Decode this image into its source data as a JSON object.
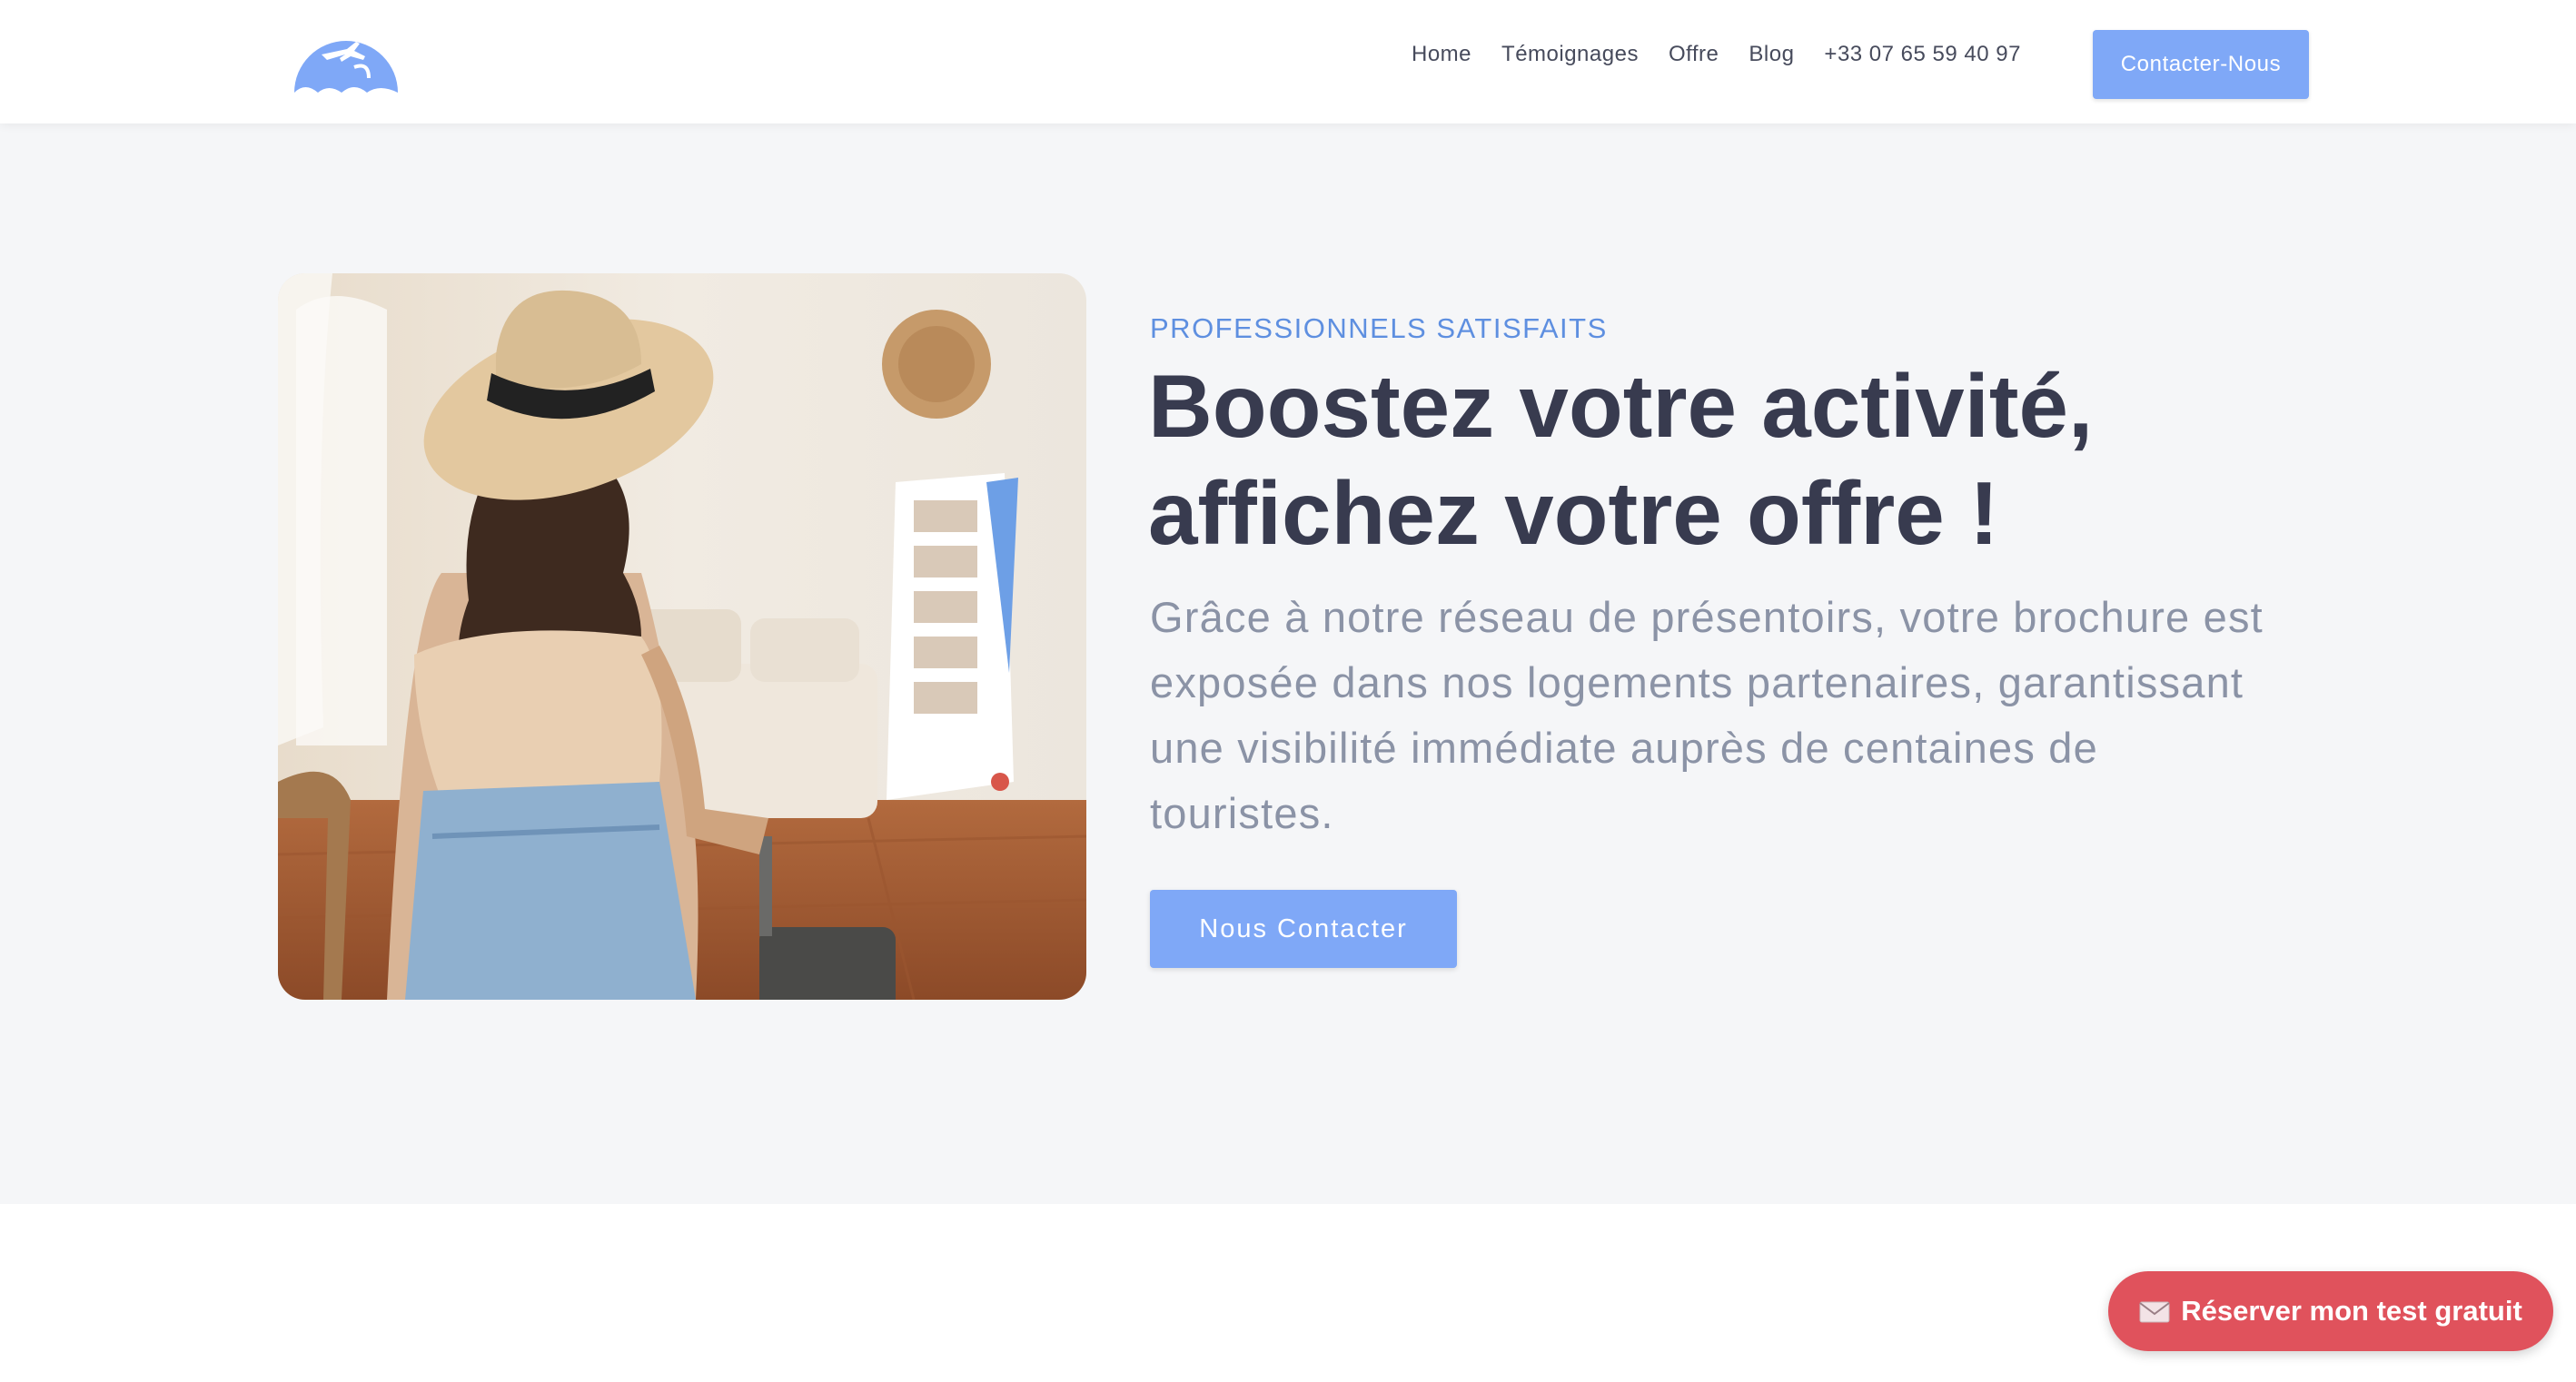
{
  "nav": {
    "items": [
      "Home",
      "Témoignages",
      "Offre",
      "Blog"
    ],
    "phone": "+33 07 65 59 40 97",
    "cta_label": "Contacter-Nous"
  },
  "hero": {
    "eyebrow": "PROFESSIONNELS SATISFAITS",
    "title_line1": "Boostez votre activité,",
    "title_line2": "affichez votre offre !",
    "description": "Grâce à notre réseau de présentoirs, votre brochure est exposée dans nos logements partenaires, garantissant une visibilité immédiate auprès de centaines de touristes.",
    "cta_label": "Nous Contacter",
    "image_icon": "traveler-photo"
  },
  "floating_cta": {
    "label": "Réserver mon test gratuit",
    "icon": "mail-icon"
  },
  "colors": {
    "accent": "#7fa8f7",
    "eyebrow": "#5e8fe0",
    "heading": "#383b4f",
    "body_text": "#8b93a6",
    "pill": "#e0525c",
    "hero_bg": "#f5f6f8"
  }
}
